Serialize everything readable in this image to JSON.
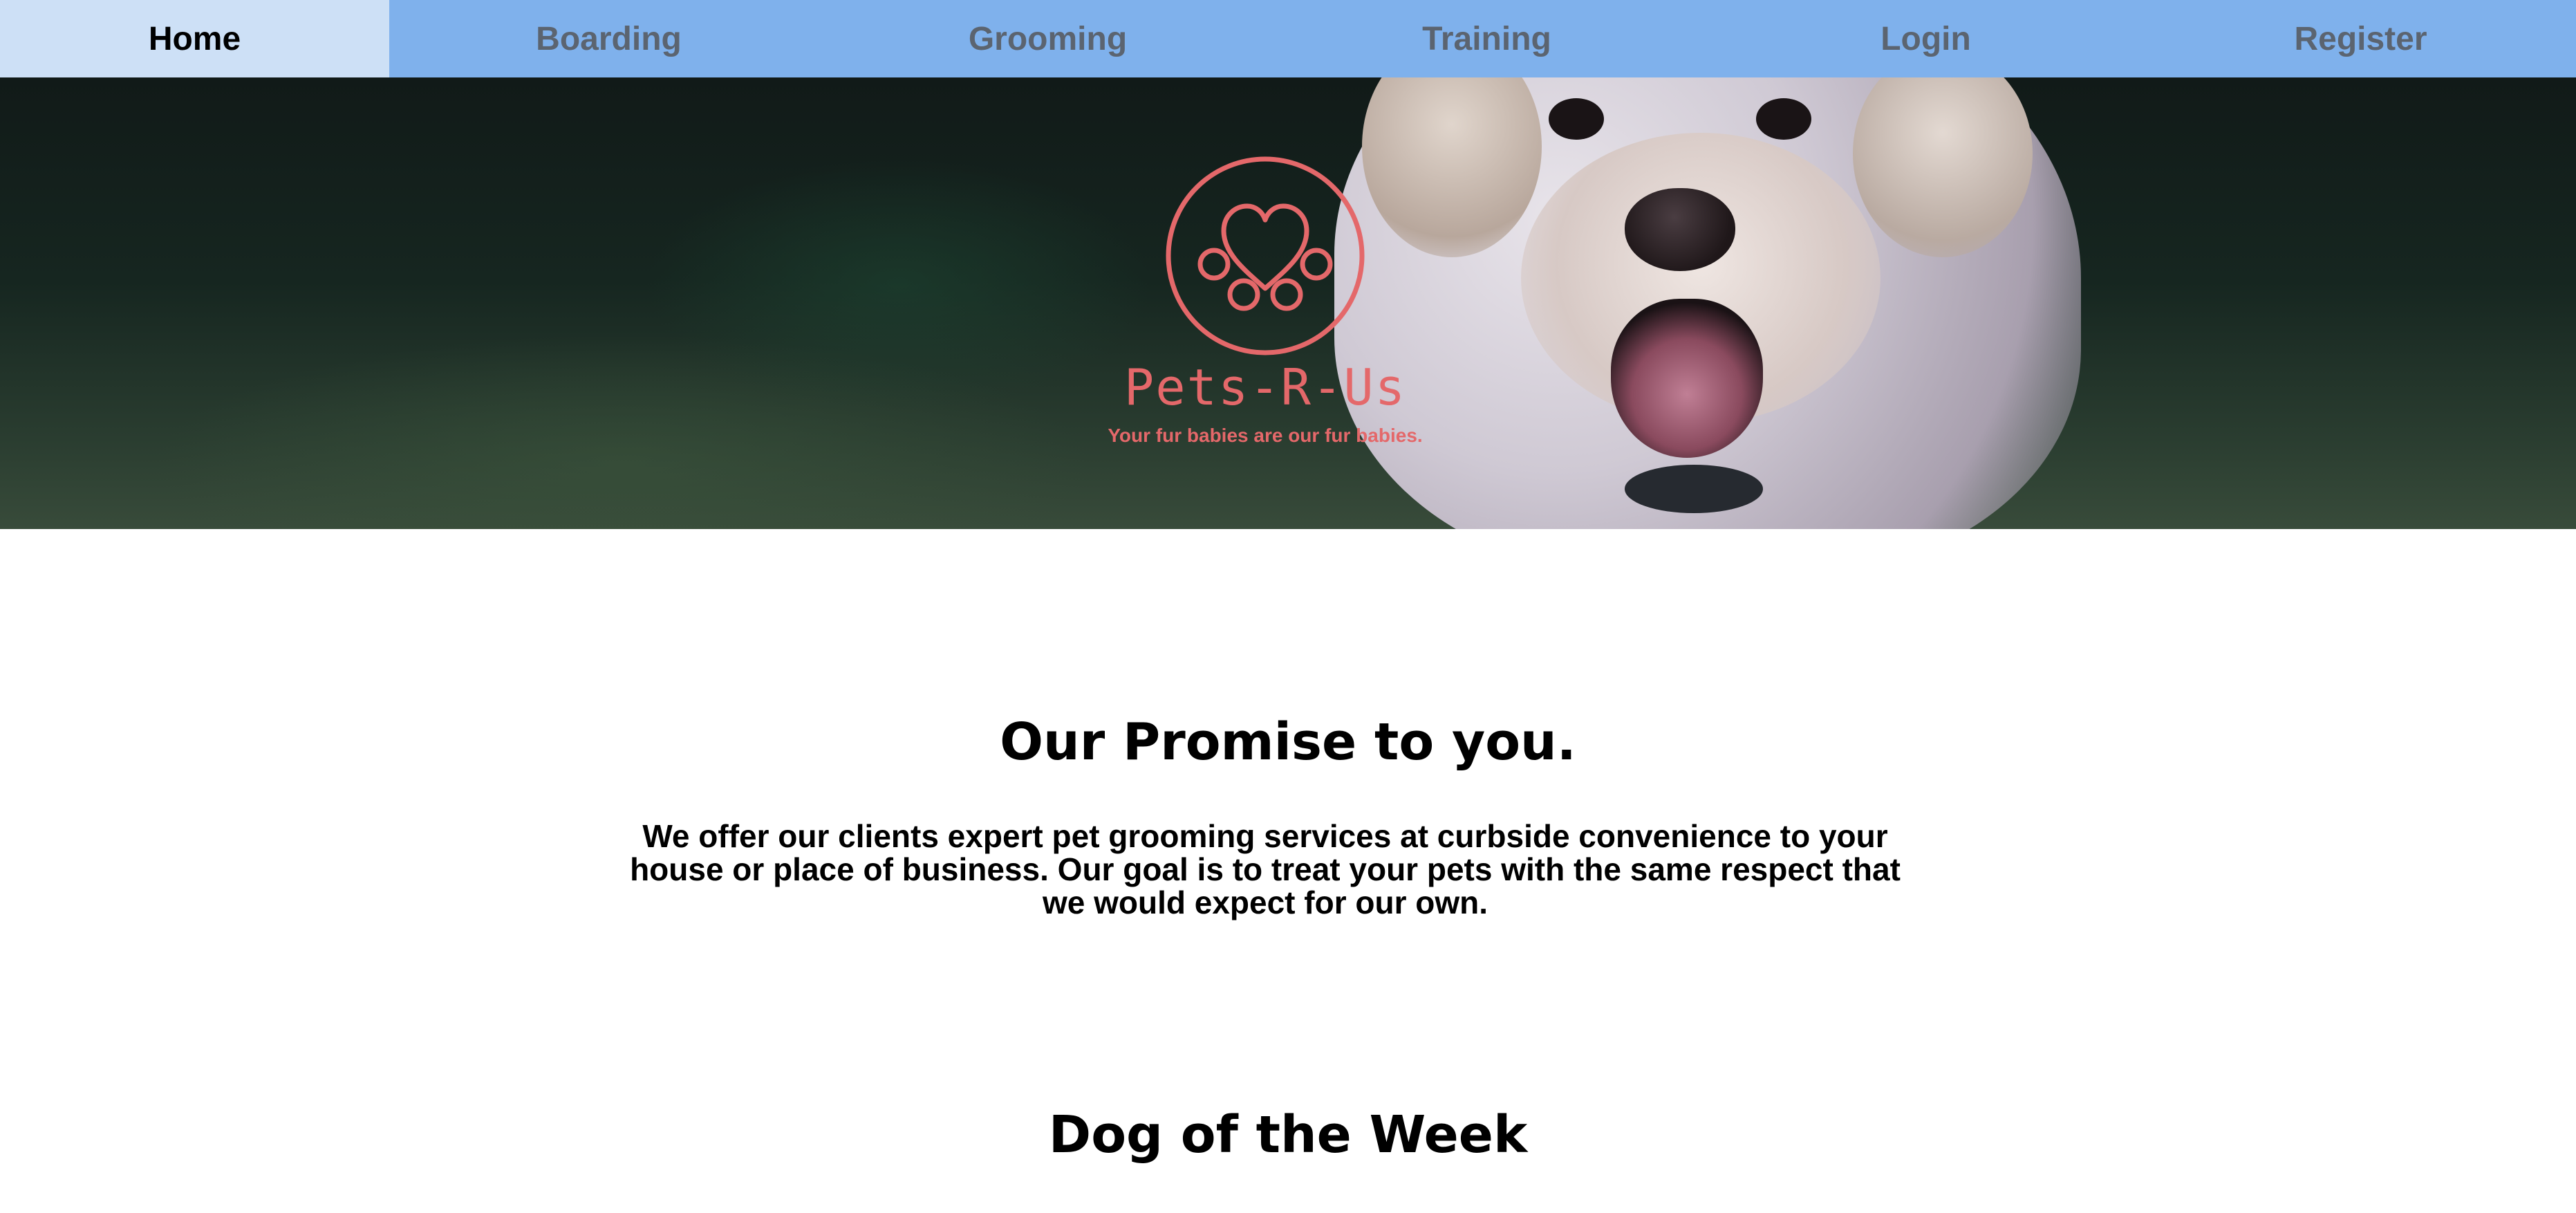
{
  "nav": {
    "items": [
      {
        "label": "Home",
        "active": true
      },
      {
        "label": "Boarding",
        "active": false
      },
      {
        "label": "Grooming",
        "active": false
      },
      {
        "label": "Training",
        "active": false
      },
      {
        "label": "Login",
        "active": false
      },
      {
        "label": "Register",
        "active": false
      }
    ]
  },
  "hero": {
    "brand": "Pets-R-Us",
    "tagline": "Your fur babies are our fur babies.",
    "logo_icon": "paw-heart-icon",
    "accent_color": "#e4686a"
  },
  "promise": {
    "title": "Our Promise to you.",
    "text": "We offer our clients expert pet grooming services at curbside convenience to your house or place of business. Our goal is to treat your pets with the same respect that we would expect for our own."
  },
  "dog_of_week": {
    "title": "Dog of the Week"
  },
  "colors": {
    "nav_bg": "#7fb1ec",
    "nav_active_bg": "#cde0f6",
    "nav_text": "#5b6470"
  }
}
